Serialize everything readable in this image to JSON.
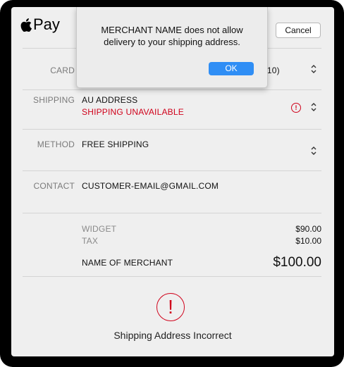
{
  "header": {
    "brand": "Pay",
    "cancel_label": "Cancel"
  },
  "card": {
    "label": "CARD",
    "value_visible": "010)"
  },
  "shipping": {
    "label": "SHIPPING",
    "address": "AU ADDRESS",
    "status": "SHIPPING UNAVAILABLE",
    "warning_glyph": "!"
  },
  "method": {
    "label": "METHOD",
    "value": "FREE SHIPPING"
  },
  "contact": {
    "label": "CONTACT",
    "value": "CUSTOMER-EMAIL@GMAIL.COM"
  },
  "summary": {
    "items": [
      {
        "label": "WIDGET",
        "amount": "$90.00"
      },
      {
        "label": "TAX",
        "amount": "$10.00"
      }
    ],
    "total_label": "NAME OF MERCHANT",
    "total_amount": "$100.00"
  },
  "footer": {
    "warning_glyph": "!",
    "message": "Shipping Address Incorrect"
  },
  "alert": {
    "line1": "MERCHANT NAME does not allow",
    "line2": "delivery to your shipping address.",
    "ok_label": "OK"
  },
  "colors": {
    "accent": "#2f8ef5",
    "error": "#d0021b",
    "panel": "#efefef"
  },
  "icons": [
    "apple-logo-icon",
    "chevron-updown-icon",
    "warning-icon"
  ]
}
